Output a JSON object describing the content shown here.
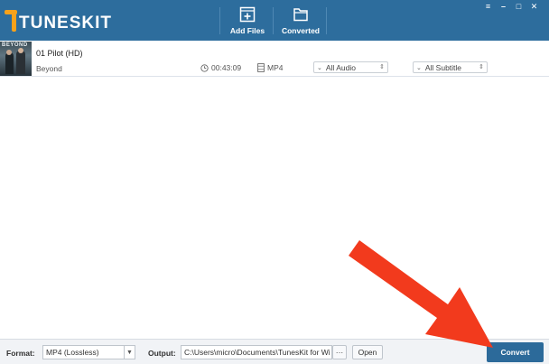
{
  "app": {
    "logo_text": "TUNESKIT",
    "colors": {
      "titlebar": "#2d6d9d",
      "accent": "#f7a21b",
      "convert_button": "#2c6a9a",
      "annotation_arrow": "#f23a1d"
    }
  },
  "toolbar": {
    "add_files_label": "Add Files",
    "add_files_icon": "add-file-icon",
    "converted_label": "Converted",
    "converted_icon": "folder-icon"
  },
  "window_controls": {
    "menu": "≡",
    "minimize": "–",
    "maximize": "□",
    "close": "✕"
  },
  "file_list": [
    {
      "title": "01 Pilot (HD)",
      "subtitle": "Beyond",
      "thumbnail_text": "BEYOND",
      "duration": "00:43:09",
      "format": "MP4",
      "audio": "All Audio",
      "subtitle_track": "All Subtitle"
    }
  ],
  "bottom": {
    "format_label": "Format:",
    "format_value": "MP4 (Lossless)",
    "output_label": "Output:",
    "output_value": "C:\\Users\\micro\\Documents\\TunesKit for Wi",
    "browse_label": "···",
    "open_label": "Open",
    "convert_label": "Convert"
  }
}
